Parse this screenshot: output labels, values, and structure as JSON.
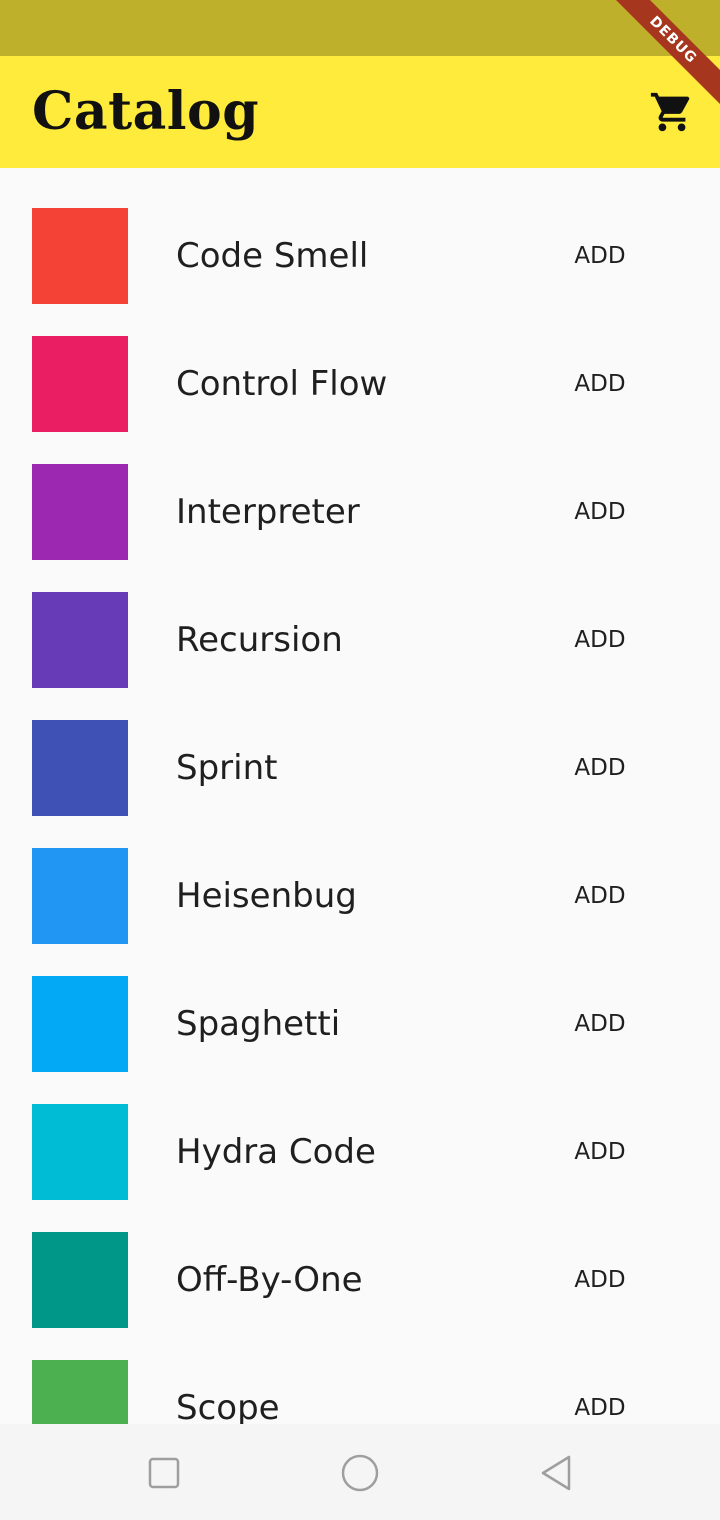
{
  "app_bar": {
    "title": "Catalog",
    "cart_icon": "shopping-cart-icon",
    "background": "#ffeb3b"
  },
  "debug_banner": {
    "label": "DEBUG"
  },
  "status_bar": {
    "background": "#bfb02b"
  },
  "items": [
    {
      "name": "Code Smell",
      "action": "ADD",
      "color": "#f44336"
    },
    {
      "name": "Control Flow",
      "action": "ADD",
      "color": "#e91e63"
    },
    {
      "name": "Interpreter",
      "action": "ADD",
      "color": "#9c27b0"
    },
    {
      "name": "Recursion",
      "action": "ADD",
      "color": "#673ab7"
    },
    {
      "name": "Sprint",
      "action": "ADD",
      "color": "#3f51b5"
    },
    {
      "name": "Heisenbug",
      "action": "ADD",
      "color": "#2196f3"
    },
    {
      "name": "Spaghetti",
      "action": "ADD",
      "color": "#03a9f4"
    },
    {
      "name": "Hydra Code",
      "action": "ADD",
      "color": "#00bcd4"
    },
    {
      "name": "Off-By-One",
      "action": "ADD",
      "color": "#009688"
    },
    {
      "name": "Scope",
      "action": "ADD",
      "color": "#4caf50"
    }
  ],
  "nav_bar": {
    "buttons": [
      "recent-apps-icon",
      "home-icon",
      "back-icon"
    ]
  }
}
